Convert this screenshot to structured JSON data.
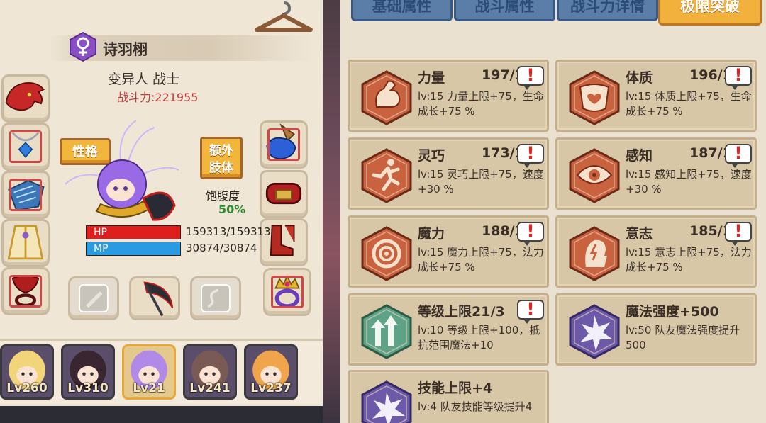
{
  "character": {
    "name": "诗羽栩",
    "gender_icon": "female-symbol-icon",
    "class": "变异人 战士",
    "combat_power": "战斗力:221955",
    "nature_button": "性格",
    "extra_limb_button": "额外肢体",
    "satiety_label": "饱腹度",
    "satiety_value": "50%",
    "hp_label": "HP",
    "hp_value": "159313/159313",
    "mp_label": "MP",
    "mp_value": "30874/30874",
    "hp_fill": 1.0,
    "mp_fill": 1.0
  },
  "equipment": {
    "left_slots": [
      "dragon-head-helm-icon",
      "blue-gem-necklace-icon",
      "blue-gauntlet-armor-icon",
      "golden-robe-icon",
      "red-rune-ring-icon"
    ],
    "right_slots": [
      "blue-glove-icon",
      "red-belt-icon",
      "red-boots-icon",
      "gold-crown-ring-icon"
    ],
    "bottom_slots": [
      "empty-sword-slot-icon",
      "scythe-weapon-icon",
      "empty-offhand-slot-icon"
    ]
  },
  "team": [
    {
      "level": "Lv260",
      "portrait": "blonde-girl-portrait"
    },
    {
      "level": "Lv310",
      "portrait": "dark-hair-girl-portrait"
    },
    {
      "level": "Lv21",
      "portrait": "purple-hair-girl-portrait",
      "selected": true
    },
    {
      "level": "Lv241",
      "portrait": "brown-hair-girl-portrait"
    },
    {
      "level": "Lv237",
      "portrait": "orange-hair-boy-portrait"
    }
  ],
  "tabs": [
    {
      "label": "基础属性"
    },
    {
      "label": "战斗属性"
    },
    {
      "label": "战斗力详情"
    },
    {
      "label": "极限突破",
      "active": true
    }
  ],
  "cards": [
    {
      "title": "力量",
      "stat": "197/1",
      "desc": "lv:15 力量上限+75，生命成长+75 %",
      "icon": "flexed-arm-icon",
      "alert": "!"
    },
    {
      "title": "体质",
      "stat": "196/1",
      "desc": "lv:15 体质上限+75，生命成长+75 %",
      "icon": "muscle-torso-heart-icon",
      "alert": "!"
    },
    {
      "title": "灵巧",
      "stat": "173/1",
      "desc": "lv:15 灵巧上限+75，速度+30 %",
      "icon": "running-man-icon",
      "alert": "!"
    },
    {
      "title": "感知",
      "stat": "187/1",
      "desc": "lv:15 感知上限+75，速度+30 %",
      "icon": "eye-icon",
      "alert": "!"
    },
    {
      "title": "魔力",
      "stat": "188/1",
      "desc": "lv:15 魔力上限+75，法力成长+75 %",
      "icon": "magic-swirl-icon",
      "alert": "!"
    },
    {
      "title": "意志",
      "stat": "185/1",
      "desc": "lv:15 意志上限+75，法力成长+75 %",
      "icon": "head-lightning-icon",
      "alert": "!"
    },
    {
      "title": "等级上限21/3",
      "stat": "",
      "desc": "lv:10 等级上限+100，抵抗范围魔法+10",
      "icon": "up-arrows-icon",
      "alert": "!"
    },
    {
      "title": "魔法强度+500",
      "stat": "",
      "desc": "lv:50 队友魔法强度提升500",
      "icon": "magic-burst-icon",
      "alert": ""
    },
    {
      "title": "技能上限+4",
      "stat": "",
      "desc": "lv:4 队友技能等级提升4",
      "icon": "skill-burst-icon",
      "alert": ""
    }
  ],
  "colors": {
    "panel_bg": "#eae1d0",
    "card_bg": "#d8c7a6",
    "hex_orange": "#c8623f",
    "hex_green": "#5ea387",
    "hex_purple": "#6c5aa8",
    "combat_power": "#c63c3c",
    "satiety_green": "#2f8a2f",
    "hp_red": "#df1e1e",
    "mp_blue": "#2a9be0",
    "active_tab": "#f2b13c",
    "inactive_tab": "#5a7ea8"
  }
}
